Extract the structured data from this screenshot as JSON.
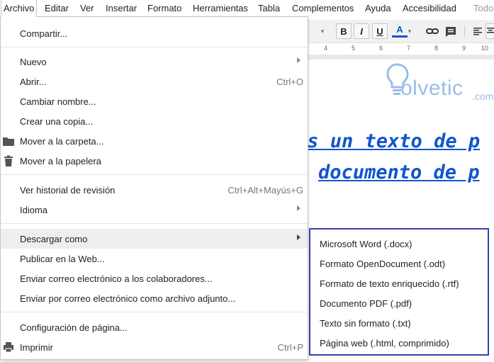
{
  "menubar": {
    "items": [
      "Archivo",
      "Editar",
      "Ver",
      "Insertar",
      "Formato",
      "Herramientas",
      "Tabla",
      "Complementos",
      "Ayuda",
      "Accesibilidad"
    ],
    "trailing": "Todos"
  },
  "file_menu": {
    "share": "Compartir...",
    "new": "Nuevo",
    "open": "Abrir...",
    "open_shortcut": "Ctrl+O",
    "rename": "Cambiar nombre...",
    "copy": "Crear una copia...",
    "move": "Mover a la carpeta...",
    "trash": "Mover a la papelera",
    "history": "Ver historial de revisión",
    "history_shortcut": "Ctrl+Alt+Mayús+G",
    "language": "Idioma",
    "download": "Descargar como",
    "publish": "Publicar en la Web...",
    "email_collab": "Enviar correo electrónico a los colaboradores...",
    "email_attach": "Enviar por correo electrónico como archivo adjunto...",
    "page_setup": "Configuración de página...",
    "print": "Imprimir",
    "print_shortcut": "Ctrl+P"
  },
  "download_submenu": [
    "Microsoft Word (.docx)",
    "Formato OpenDocument (.odt)",
    "Formato de texto enriquecido (.rtf)",
    "Documento PDF (.pdf)",
    "Texto sin formato (.txt)",
    "Página web (.html, comprimido)"
  ],
  "toolbar": {
    "bold": "B",
    "italic": "I",
    "underline": "U",
    "text_color": "A"
  },
  "ruler": [
    "4",
    "5",
    "6",
    "7",
    "8",
    "9",
    "10"
  ],
  "document": {
    "logo": "olvetic",
    "logo_suffix": ".com",
    "line1": "es un texto de p",
    "line2": "documento de p"
  },
  "colors": {
    "link_blue": "#1155cc",
    "submenu_border": "#3b3fa6",
    "highlight": "#eeeeee"
  }
}
